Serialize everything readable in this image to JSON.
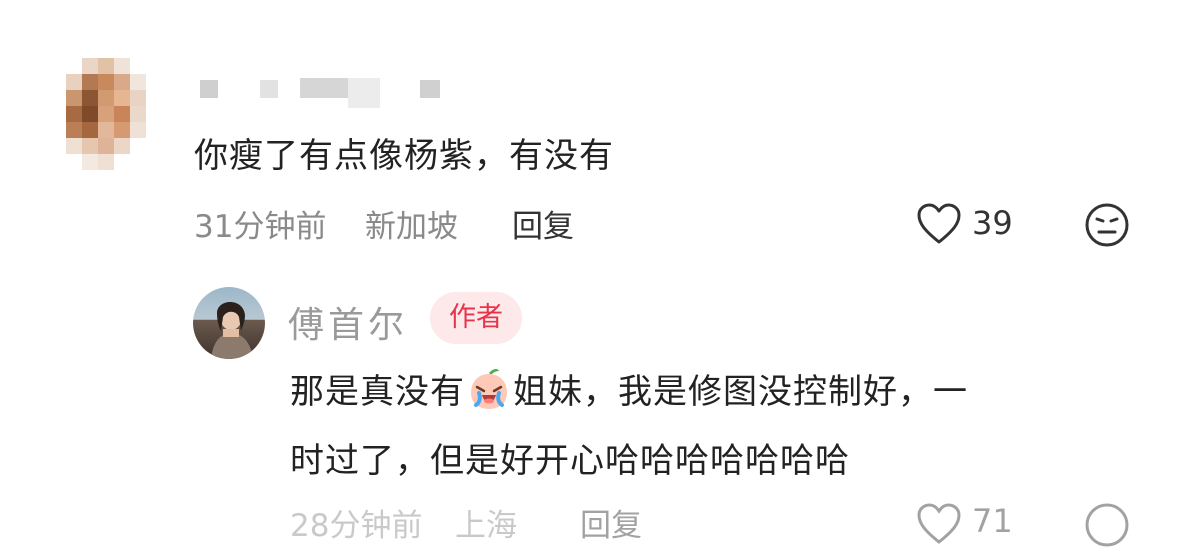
{
  "comment": {
    "text": "你瘦了有点像杨紫，有没有",
    "time": "31分钟前",
    "location": "新加坡",
    "reply_label": "回复",
    "like_count": "39",
    "like_icon": "heart-outline-icon",
    "dislike_icon": "meh-face-icon"
  },
  "reply": {
    "author_name": "傅首尔",
    "author_badge": "作者",
    "text_part1": "那是真没有",
    "emoji": "crying-laughing-peach-icon",
    "text_part2": "姐妹，我是修图没控制好，一",
    "text_line2": "时过了，但是好开心哈哈哈哈哈哈哈",
    "time": "28分钟前",
    "location": "上海",
    "reply_label": "回复",
    "like_count": "71"
  },
  "colors": {
    "badge_bg": "#fde8ea",
    "badge_text": "#e6344a",
    "meta_gray": "#8a8a8a"
  }
}
